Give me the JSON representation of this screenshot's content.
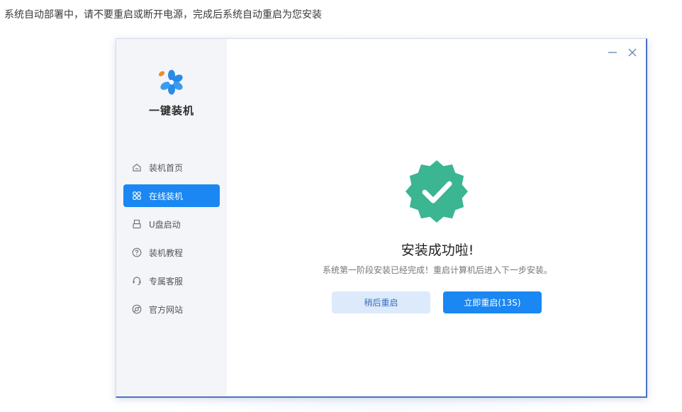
{
  "caption": "系统自动部署中，请不要重启或断开电源，完成后系统自动重启为您安装",
  "app": {
    "logo_text": "一键装机",
    "brand_colors": {
      "accent": "#1a87f2",
      "success": "#3bb592",
      "logo_blue": "#2a8be6",
      "logo_orange": "#f08a2c"
    }
  },
  "sidebar": {
    "items": [
      {
        "label": "装机首页",
        "icon": "home-icon",
        "active": false
      },
      {
        "label": "在线装机",
        "icon": "install-icon",
        "active": true
      },
      {
        "label": "U盘启动",
        "icon": "usb-icon",
        "active": false
      },
      {
        "label": "装机教程",
        "icon": "help-icon",
        "active": false
      },
      {
        "label": "专属客服",
        "icon": "headset-icon",
        "active": false
      },
      {
        "label": "官方网站",
        "icon": "globe-icon",
        "active": false
      }
    ]
  },
  "window_controls": {
    "minimize": "minimize-icon",
    "close": "close-icon"
  },
  "main": {
    "title": "安装成功啦!",
    "description": "系统第一阶段安装已经完成！重启计算机后进入下一步安装。",
    "buttons": {
      "later": "稍后重启",
      "now": "立即重启(13S)"
    }
  }
}
